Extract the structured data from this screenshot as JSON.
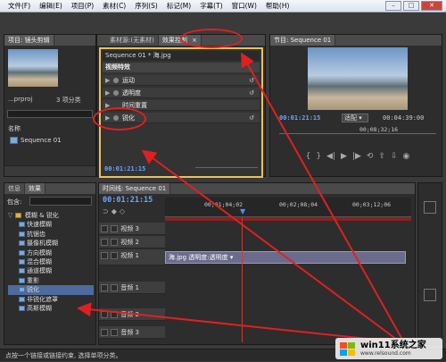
{
  "menubar": {
    "items": [
      "文件(F)",
      "编辑(E)",
      "项目(P)",
      "素材(C)",
      "序列(S)",
      "标记(M)",
      "字幕(T)",
      "窗口(W)",
      "帮助(H)"
    ]
  },
  "project_panel": {
    "tab_label": "项目: 镜头剪辑",
    "file_name": "...prproj",
    "item_count": "3 项分类",
    "column_name": "名称",
    "item": "Sequence 01"
  },
  "effect_controls": {
    "tab_source": "素材源:(无素材)",
    "tab_label": "效果控制",
    "tab_close": "×",
    "clip_name": "Sequence 01 * 海.jpg",
    "section_title": "视频特效",
    "effects": [
      "运动",
      "透明度",
      "时间重置",
      "锐化"
    ],
    "timecode": "00:01:21:15"
  },
  "program_monitor": {
    "tab_label": "节目: Sequence 01",
    "timecode_current": "00:01:21:15",
    "fit_label": "适配",
    "timecode_duration": "00:04:39:00",
    "ruler_mark": "00;08;32;16"
  },
  "effects_panel": {
    "tab_info": "信息",
    "tab_effects": "效果",
    "contains_label": "包含:",
    "folder": "模糊 & 锐化",
    "items": [
      "快速模糊",
      "抗锯齿",
      "摄像机模糊",
      "方向模糊",
      "混合模糊",
      "通道模糊",
      "重影",
      "锐化",
      "非锐化遮罩",
      "高斯模糊"
    ],
    "selected_index": 7
  },
  "timeline": {
    "tab_label": "时间线: Sequence 01",
    "timecode": "00:01:21:15",
    "ruler_marks": [
      "00;01;04;02",
      "00;02;08;04",
      "00;03;12;06"
    ],
    "tracks": [
      "视频 3",
      "视频 2",
      "视频 1",
      "音频 1",
      "音频 2",
      "音频 3"
    ],
    "clip_label": "海.jpg 透明度:透明度 ▾"
  },
  "status_bar": {
    "text": "点按一个链接或链接约束, 选择单项分类。"
  },
  "watermark": {
    "title": "win11系统之家",
    "url": "www.relsound.com"
  },
  "colors": {
    "annotation_red": "#e02020",
    "timecode_blue": "#6aa6ff",
    "selection_blue": "#4d6b9c"
  }
}
